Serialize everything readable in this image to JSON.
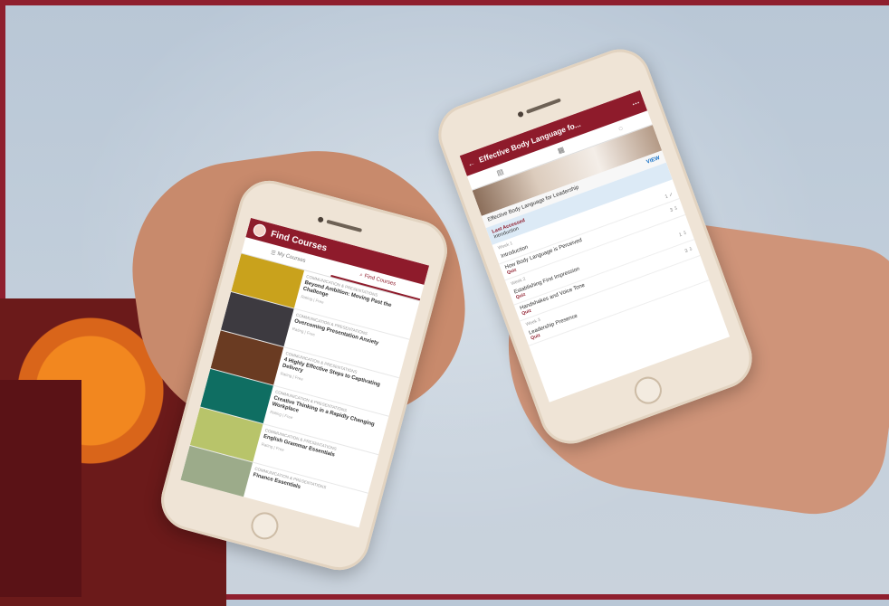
{
  "phone_left": {
    "app_title": "Find Courses",
    "tabs": [
      "My Courses",
      "Find Courses"
    ],
    "courses": [
      {
        "category": "COMMUNICATION & PRESENTATIONS",
        "title": "Beyond Ambition: Moving Past the Challenge",
        "meta": "Rating | Free"
      },
      {
        "category": "COMMUNICATION & PRESENTATIONS",
        "title": "Overcoming Presentation Anxiety",
        "meta": "Rating | Free"
      },
      {
        "category": "COMMUNICATION & PRESENTATIONS",
        "title": "4 Highly Effective Steps to Captivating Delivery",
        "meta": "Rating | Free"
      },
      {
        "category": "COMMUNICATION & PRESENTATIONS",
        "title": "Creative Thinking in a Rapidly Changing Workplace",
        "meta": "Rating | Free"
      },
      {
        "category": "COMMUNICATION & PRESENTATIONS",
        "title": "English Grammar Essentials",
        "meta": "Rating | Free"
      },
      {
        "category": "COMMUNICATION & PRESENTATIONS",
        "title": "Finance Essentials",
        "meta": ""
      }
    ],
    "thumb_colors": [
      "#c9a21c",
      "#3d3a40",
      "#6a3b22",
      "#0f6e62",
      "#b8c46a",
      "#9cab8a"
    ]
  },
  "phone_right": {
    "app_title": "Effective Body Language fo...",
    "course_title": "Effective Body Language for Leadership",
    "view_label": "VIEW",
    "last_accessed_label": "Last Accessed",
    "last_accessed_value": "Introduction",
    "weeks": [
      {
        "label": "Week 1",
        "lessons": [
          {
            "title": "Introduction",
            "count": "1 ✓",
            "sub": ""
          },
          {
            "title": "How Body Language is Perceived",
            "count": "3 ⇩",
            "sub": "Quiz"
          }
        ]
      },
      {
        "label": "Week 2",
        "lessons": [
          {
            "title": "Establishing First Impression",
            "count": "1 ⇩",
            "sub": "Quiz"
          },
          {
            "title": "Handshakes and Voice Tone",
            "count": "3 ⇩",
            "sub": "Quiz"
          }
        ]
      },
      {
        "label": "Week 3",
        "lessons": [
          {
            "title": "Leadership Presence",
            "count": "",
            "sub": "Quiz"
          }
        ]
      }
    ]
  },
  "colors": {
    "brand": "#8e1b2b",
    "link": "#1a73c7"
  }
}
